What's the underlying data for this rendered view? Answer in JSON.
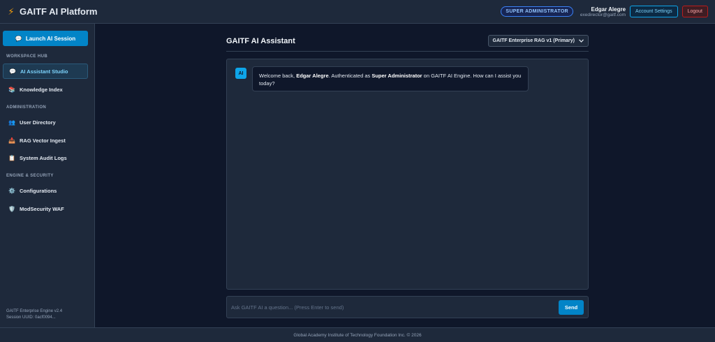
{
  "header": {
    "brand_icon": "lightning-bolt-icon",
    "brand_icon_glyph": "⚡",
    "title": "GAITF AI Platform",
    "role_badge": "SUPER ADMINISTRATOR",
    "user_name": "Edgar Alegre",
    "user_email": "exedirector@gaitf.com",
    "account_label": "Account Settings",
    "logout_label": "Logout"
  },
  "sidebar": {
    "launch": {
      "icon": "chat-bubble-icon",
      "glyph": "💬",
      "label": "Launch AI Session"
    },
    "sections": [
      {
        "label": "WORKSPACE HUB"
      },
      {
        "label": "ADMINISTRATION"
      },
      {
        "label": "ENGINE & SECURITY"
      }
    ],
    "items": [
      {
        "icon": "chat-bubble-icon",
        "glyph": "💬",
        "label": "AI Assistant Studio",
        "active": true
      },
      {
        "icon": "books-icon",
        "glyph": "📚",
        "label": "Knowledge Index"
      },
      {
        "icon": "users-icon",
        "glyph": "👥",
        "label": "User Directory"
      },
      {
        "icon": "inbox-tray-icon",
        "glyph": "📥",
        "label": "RAG Vector Ingest"
      },
      {
        "icon": "clipboard-icon",
        "glyph": "📋",
        "label": "System Audit Logs"
      },
      {
        "icon": "gear-icon",
        "glyph": "⚙️",
        "label": "Configurations"
      },
      {
        "icon": "shield-icon",
        "glyph": "🛡️",
        "label": "ModSecurity WAF"
      }
    ],
    "footer_version": "GAITF Enterprise Engine v2.4",
    "footer_session": "Session UUID: 0acf0094..."
  },
  "main": {
    "title": "GAITF AI Assistant",
    "model_selected": "GAITF Enterprise RAG v1 (Primary)",
    "chevron_icon": "chevron-down-icon",
    "messages": [
      {
        "avatar": "AI",
        "parts": [
          {
            "text": "Welcome back, ",
            "bold": false
          },
          {
            "text": "Edgar Alegre",
            "bold": true
          },
          {
            "text": ". Authenticated as ",
            "bold": false
          },
          {
            "text": "Super Administrator",
            "bold": true
          },
          {
            "text": " on GAITF AI Engine. How can I assist you today?",
            "bold": false
          }
        ]
      }
    ],
    "input_placeholder": "Ask GAITF AI a question... (Press Enter to send)",
    "send_label": "Send"
  },
  "footer": {
    "text": "Global Academy Institute of Technology Foundation Inc. © 2026"
  }
}
